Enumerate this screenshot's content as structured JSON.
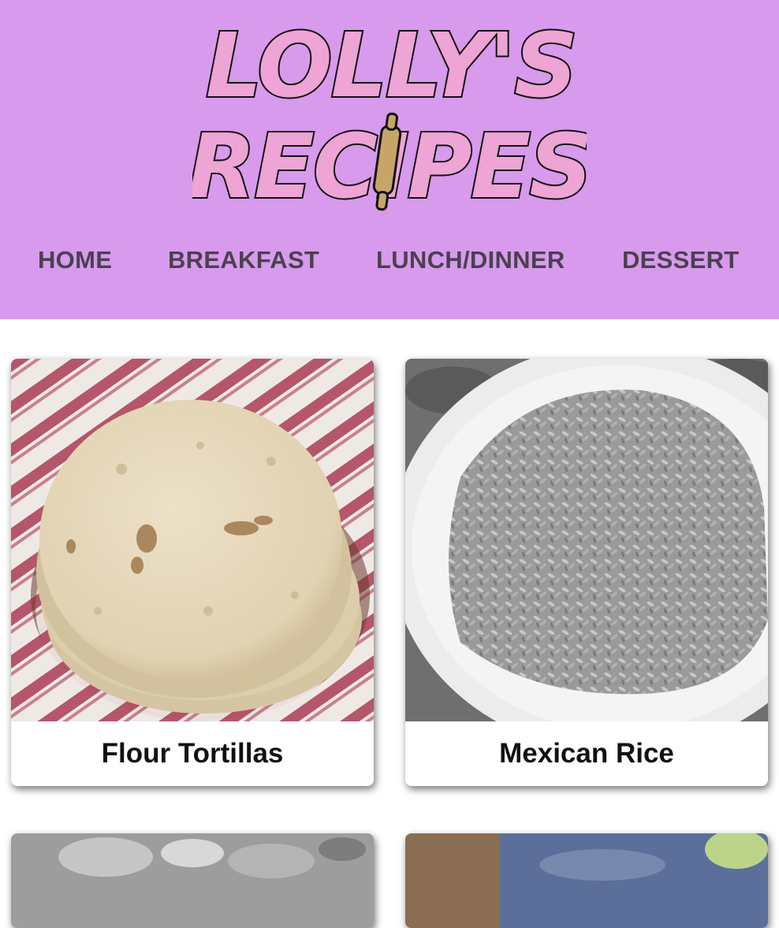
{
  "logo": {
    "line1": "LOLLY'S",
    "line2": "RECIPES",
    "rolling_pin_icon": "rolling-pin-icon"
  },
  "nav": {
    "items": [
      {
        "label": "HOME"
      },
      {
        "label": "BREAKFAST"
      },
      {
        "label": "LUNCH/DINNER"
      },
      {
        "label": "DESSERT"
      }
    ]
  },
  "recipes": [
    {
      "title": "Flour Tortillas"
    },
    {
      "title": "Mexican Rice"
    }
  ],
  "colors": {
    "header_bg": "#d89aec",
    "logo_fill": "#eea4d4",
    "nav_text": "#4a4150"
  }
}
